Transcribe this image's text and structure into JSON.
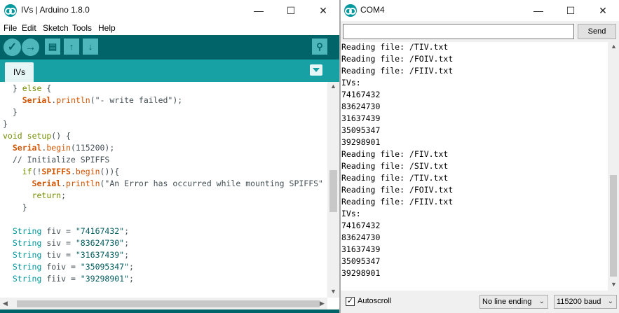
{
  "ide": {
    "title": "IVs | Arduino 1.8.0",
    "window_controls": {
      "minimize": "—",
      "maximize": "☐",
      "close": "✕"
    },
    "menu": [
      "File",
      "Edit",
      "Sketch",
      "Tools",
      "Help"
    ],
    "toolbar_icons": [
      "verify-icon",
      "upload-icon",
      "new-icon",
      "open-icon",
      "save-icon",
      "serial-monitor-icon"
    ],
    "tab": {
      "label": "IVs"
    },
    "code_lines": [
      [
        {
          "t": "  } "
        },
        {
          "t": "else",
          "c": "kw"
        },
        {
          "t": " {"
        }
      ],
      [
        {
          "t": "    "
        },
        {
          "t": "Serial",
          "c": "cls"
        },
        {
          "t": "."
        },
        {
          "t": "println",
          "c": "fn"
        },
        {
          "t": "(\"- write failed\");"
        }
      ],
      [
        {
          "t": "  }"
        }
      ],
      [
        {
          "t": "}"
        }
      ],
      [
        {
          "t": "void",
          "c": "kw"
        },
        {
          "t": " "
        },
        {
          "t": "setup",
          "c": "kw"
        },
        {
          "t": "() {"
        }
      ],
      [
        {
          "t": "  "
        },
        {
          "t": "Serial",
          "c": "cls"
        },
        {
          "t": "."
        },
        {
          "t": "begin",
          "c": "fn"
        },
        {
          "t": "(115200);"
        }
      ],
      [
        {
          "t": "  // Initialize SPIFFS"
        }
      ],
      [
        {
          "t": "    "
        },
        {
          "t": "if",
          "c": "kw"
        },
        {
          "t": "(!"
        },
        {
          "t": "SPIFFS",
          "c": "cls"
        },
        {
          "t": "."
        },
        {
          "t": "begin",
          "c": "fn"
        },
        {
          "t": "()){"
        }
      ],
      [
        {
          "t": "      "
        },
        {
          "t": "Serial",
          "c": "cls"
        },
        {
          "t": "."
        },
        {
          "t": "println",
          "c": "fn"
        },
        {
          "t": "(\"An Error has occurred while mounting SPIFFS\""
        }
      ],
      [
        {
          "t": "      "
        },
        {
          "t": "return",
          "c": "kw"
        },
        {
          "t": ";"
        }
      ],
      [
        {
          "t": "    }"
        }
      ],
      [
        {
          "t": ""
        }
      ],
      [
        {
          "t": "  "
        },
        {
          "t": "String",
          "c": "typ"
        },
        {
          "t": " fiv = "
        },
        {
          "t": "\"74167432\"",
          "c": "str"
        },
        {
          "t": ";"
        }
      ],
      [
        {
          "t": "  "
        },
        {
          "t": "String",
          "c": "typ"
        },
        {
          "t": " siv = "
        },
        {
          "t": "\"83624730\"",
          "c": "str"
        },
        {
          "t": ";"
        }
      ],
      [
        {
          "t": "  "
        },
        {
          "t": "String",
          "c": "typ"
        },
        {
          "t": " tiv = "
        },
        {
          "t": "\"31637439\"",
          "c": "str"
        },
        {
          "t": ";"
        }
      ],
      [
        {
          "t": "  "
        },
        {
          "t": "String",
          "c": "typ"
        },
        {
          "t": " foiv = "
        },
        {
          "t": "\"35095347\"",
          "c": "str"
        },
        {
          "t": ";"
        }
      ],
      [
        {
          "t": "  "
        },
        {
          "t": "String",
          "c": "typ"
        },
        {
          "t": " fiiv = "
        },
        {
          "t": "\"39298901\"",
          "c": "str"
        },
        {
          "t": ";"
        }
      ]
    ]
  },
  "serial": {
    "title": "COM4",
    "window_controls": {
      "minimize": "—",
      "maximize": "☐",
      "close": "✕"
    },
    "input": {
      "value": "",
      "placeholder": ""
    },
    "send_label": "Send",
    "output_lines": [
      "Reading file: /TIV.txt",
      "Reading file: /FOIV.txt",
      "Reading file: /FIIV.txt",
      "IVs:",
      "74167432",
      "83624730",
      "31637439",
      "35095347",
      "39298901",
      "Reading file: /FIV.txt",
      "Reading file: /SIV.txt",
      "Reading file: /TIV.txt",
      "Reading file: /FOIV.txt",
      "Reading file: /FIIV.txt",
      "IVs:",
      "74167432",
      "83624730",
      "31637439",
      "35095347",
      "39298901"
    ],
    "autoscroll": {
      "label": "Autoscroll",
      "checked": true,
      "mark": "✓"
    },
    "line_ending": "No line ending",
    "baud": "115200 baud"
  },
  "colors": {
    "toolbar": "#006468",
    "tabbar": "#17a1a5",
    "keyword": "#728e00",
    "function": "#d35400",
    "type": "#00979c"
  }
}
